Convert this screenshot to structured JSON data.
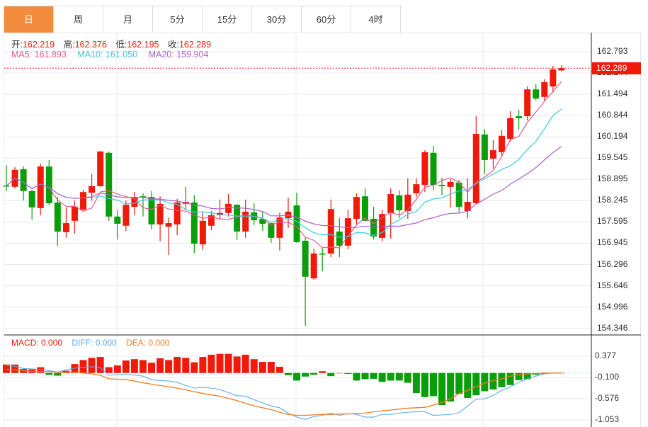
{
  "tabs": [
    {
      "label": "日",
      "active": true
    },
    {
      "label": "周"
    },
    {
      "label": "月"
    },
    {
      "label": "5分"
    },
    {
      "label": "15分"
    },
    {
      "label": "30分"
    },
    {
      "label": "60分"
    },
    {
      "label": "4时"
    }
  ],
  "ohlc_info": {
    "open_label": "开:",
    "open": "162.219",
    "high_label": "高:",
    "high": "162.376",
    "low_label": "低:",
    "low": "162.195",
    "close_label": "收:",
    "close": "162.289"
  },
  "ma_info": {
    "ma5": "MA5: 161.893",
    "ma10": "MA10: 161.050",
    "ma20": "MA20: 159.904"
  },
  "macd_info": {
    "macd": "MACD: 0.000",
    "diff": "DIFF: 0.000",
    "dea": "DEA: 0.000"
  },
  "current_price": "162.289",
  "colors": {
    "up": "#f01a0a",
    "down": "#0a9e0a",
    "tab_active": "#f28c3c",
    "ma5": "#ea5b8c",
    "ma10": "#3ec9e0",
    "ma20": "#b35ccf",
    "diff": "#5aaaf0",
    "dea": "#f57c1e"
  },
  "chart_data": {
    "type": "candlestick",
    "price_axis": [
      "162.793",
      "162.144",
      "161.494",
      "160.844",
      "160.194",
      "159.545",
      "158.895",
      "158.245",
      "157.595",
      "156.945",
      "156.296",
      "155.646",
      "154.996",
      "154.346"
    ],
    "ylim": [
      154.346,
      162.793
    ],
    "macd_axis": [
      "0.377",
      "-0.100",
      "-0.576",
      "-1.053"
    ],
    "macd_ylim": [
      -1.053,
      0.377
    ],
    "candles": [
      [
        158.7,
        159.33,
        158.53,
        158.68
      ],
      [
        158.66,
        159.26,
        158.61,
        159.18
      ],
      [
        159.2,
        159.28,
        158.24,
        158.53
      ],
      [
        158.53,
        158.57,
        157.66,
        158.03
      ],
      [
        158.01,
        159.37,
        157.79,
        159.28
      ],
      [
        159.28,
        159.48,
        158.09,
        158.16
      ],
      [
        158.18,
        158.35,
        156.86,
        157.29
      ],
      [
        157.27,
        158.03,
        157.1,
        157.55
      ],
      [
        157.62,
        158.24,
        157.23,
        158.05
      ],
      [
        157.96,
        158.57,
        157.94,
        158.5
      ],
      [
        158.48,
        159.05,
        158.24,
        158.68
      ],
      [
        158.68,
        159.76,
        158.66,
        159.74
      ],
      [
        159.7,
        159.74,
        157.62,
        157.75
      ],
      [
        157.75,
        157.94,
        157.05,
        157.53
      ],
      [
        157.47,
        158.24,
        157.31,
        158.11
      ],
      [
        158.05,
        158.5,
        157.79,
        158.35
      ],
      [
        158.37,
        158.46,
        157.75,
        158.35
      ],
      [
        158.35,
        158.53,
        157.36,
        157.51
      ],
      [
        157.51,
        158.37,
        156.99,
        158.14
      ],
      [
        157.44,
        157.72,
        156.58,
        157.55
      ],
      [
        157.51,
        158.29,
        157.18,
        158.18
      ],
      [
        158.14,
        158.66,
        157.98,
        158.2
      ],
      [
        158.18,
        158.4,
        156.64,
        156.92
      ],
      [
        156.9,
        157.9,
        156.73,
        157.62
      ],
      [
        157.47,
        157.92,
        157.33,
        157.79
      ],
      [
        157.79,
        158.27,
        157.66,
        157.86
      ],
      [
        157.86,
        158.44,
        157.75,
        158.14
      ],
      [
        158.11,
        158.13,
        157.03,
        157.29
      ],
      [
        157.29,
        158.27,
        157.1,
        157.9
      ],
      [
        157.88,
        158.16,
        157.49,
        157.64
      ],
      [
        157.68,
        157.9,
        157.31,
        157.53
      ],
      [
        157.55,
        157.56,
        156.95,
        157.1
      ],
      [
        157.1,
        157.86,
        156.71,
        157.72
      ],
      [
        157.7,
        158.33,
        157.4,
        157.9
      ],
      [
        158.09,
        158.48,
        156.95,
        156.97
      ],
      [
        157.01,
        157.12,
        154.41,
        155.91
      ],
      [
        155.86,
        156.77,
        155.82,
        156.62
      ],
      [
        156.62,
        156.79,
        156.08,
        156.6
      ],
      [
        156.62,
        158.27,
        156.51,
        157.98
      ],
      [
        157.29,
        157.7,
        156.51,
        156.86
      ],
      [
        156.86,
        157.96,
        156.75,
        157.7
      ],
      [
        157.68,
        158.46,
        157.51,
        158.35
      ],
      [
        158.37,
        158.61,
        157.62,
        157.62
      ],
      [
        157.68,
        158.05,
        157.05,
        157.14
      ],
      [
        157.1,
        157.96,
        156.99,
        157.83
      ],
      [
        157.86,
        158.61,
        157.08,
        158.44
      ],
      [
        158.4,
        158.55,
        157.7,
        157.94
      ],
      [
        157.92,
        158.92,
        157.68,
        158.42
      ],
      [
        158.46,
        158.92,
        158.35,
        158.74
      ],
      [
        158.72,
        159.78,
        158.5,
        159.72
      ],
      [
        159.7,
        159.91,
        158.55,
        158.72
      ],
      [
        158.72,
        158.94,
        158.4,
        158.68
      ],
      [
        158.66,
        158.89,
        158.03,
        158.81
      ],
      [
        158.79,
        158.87,
        157.88,
        158.05
      ],
      [
        157.92,
        158.92,
        157.7,
        158.2
      ],
      [
        158.16,
        160.82,
        158.14,
        160.28
      ],
      [
        160.26,
        160.43,
        159.05,
        159.48
      ],
      [
        159.52,
        160.09,
        159.22,
        159.78
      ],
      [
        159.72,
        160.39,
        159.6,
        160.22
      ],
      [
        160.13,
        160.97,
        160.05,
        160.76
      ],
      [
        160.82,
        161.02,
        160.41,
        160.76
      ],
      [
        160.82,
        161.73,
        160.69,
        161.64
      ],
      [
        161.64,
        161.8,
        161.3,
        161.36
      ],
      [
        161.41,
        161.95,
        161.3,
        161.86
      ],
      [
        161.73,
        162.36,
        161.54,
        162.25
      ],
      [
        162.219,
        162.376,
        162.195,
        162.289
      ]
    ],
    "macd_hist": [
      0.19,
      0.19,
      0.09,
      0.08,
      0.13,
      -0.04,
      -0.06,
      0.05,
      0.2,
      0.29,
      0.34,
      0.36,
      0.13,
      0.17,
      0.28,
      0.31,
      0.29,
      0.23,
      0.33,
      0.29,
      0.36,
      0.34,
      0.24,
      0.36,
      0.41,
      0.43,
      0.43,
      0.37,
      0.41,
      0.31,
      0.25,
      0.25,
      0.14,
      -0.05,
      -0.17,
      -0.08,
      -0.04,
      0.04,
      -0.07,
      0.0,
      -0.02,
      -0.17,
      -0.14,
      -0.13,
      -0.2,
      -0.17,
      -0.17,
      -0.22,
      -0.45,
      -0.54,
      -0.52,
      -0.72,
      -0.64,
      -0.47,
      -0.56,
      -0.5,
      -0.41,
      -0.37,
      -0.32,
      -0.27,
      -0.16,
      -0.14,
      -0.04,
      -0.02,
      -0.01,
      0.0
    ],
    "diff": [
      0.17,
      0.15,
      0.1,
      0.09,
      0.08,
      0.05,
      0.02,
      0.07,
      0.11,
      0.13,
      0.14,
      0.12,
      -0.05,
      -0.04,
      -0.03,
      -0.05,
      -0.07,
      -0.15,
      -0.17,
      -0.18,
      -0.21,
      -0.28,
      -0.34,
      -0.32,
      -0.34,
      -0.37,
      -0.44,
      -0.51,
      -0.52,
      -0.6,
      -0.67,
      -0.74,
      -0.78,
      -0.9,
      -0.99,
      -1.04,
      -0.98,
      -0.95,
      -0.9,
      -0.95,
      -0.91,
      -0.93,
      -0.99,
      -0.99,
      -0.93,
      -0.93,
      -0.9,
      -0.88,
      -0.87,
      -0.87,
      -0.95,
      -0.94,
      -0.93,
      -0.89,
      -0.74,
      -0.59,
      -0.58,
      -0.5,
      -0.39,
      -0.31,
      -0.21,
      -0.13,
      -0.07,
      -0.02,
      0.0,
      0.0
    ],
    "dea": [
      0.08,
      0.07,
      0.05,
      0.04,
      0.03,
      0.03,
      0.02,
      0.02,
      0.02,
      0.0,
      -0.02,
      -0.05,
      -0.13,
      -0.14,
      -0.15,
      -0.18,
      -0.22,
      -0.25,
      -0.28,
      -0.31,
      -0.34,
      -0.38,
      -0.42,
      -0.46,
      -0.49,
      -0.52,
      -0.57,
      -0.62,
      -0.68,
      -0.74,
      -0.78,
      -0.82,
      -0.88,
      -0.93,
      -0.95,
      -0.95,
      -0.94,
      -0.93,
      -0.93,
      -0.92,
      -0.92,
      -0.91,
      -0.9,
      -0.87,
      -0.85,
      -0.83,
      -0.81,
      -0.79,
      -0.78,
      -0.77,
      -0.72,
      -0.66,
      -0.58,
      -0.46,
      -0.39,
      -0.31,
      -0.23,
      -0.17,
      -0.13,
      -0.07,
      -0.04,
      -0.02,
      -0.01,
      0.0,
      0.0,
      0.0
    ]
  }
}
